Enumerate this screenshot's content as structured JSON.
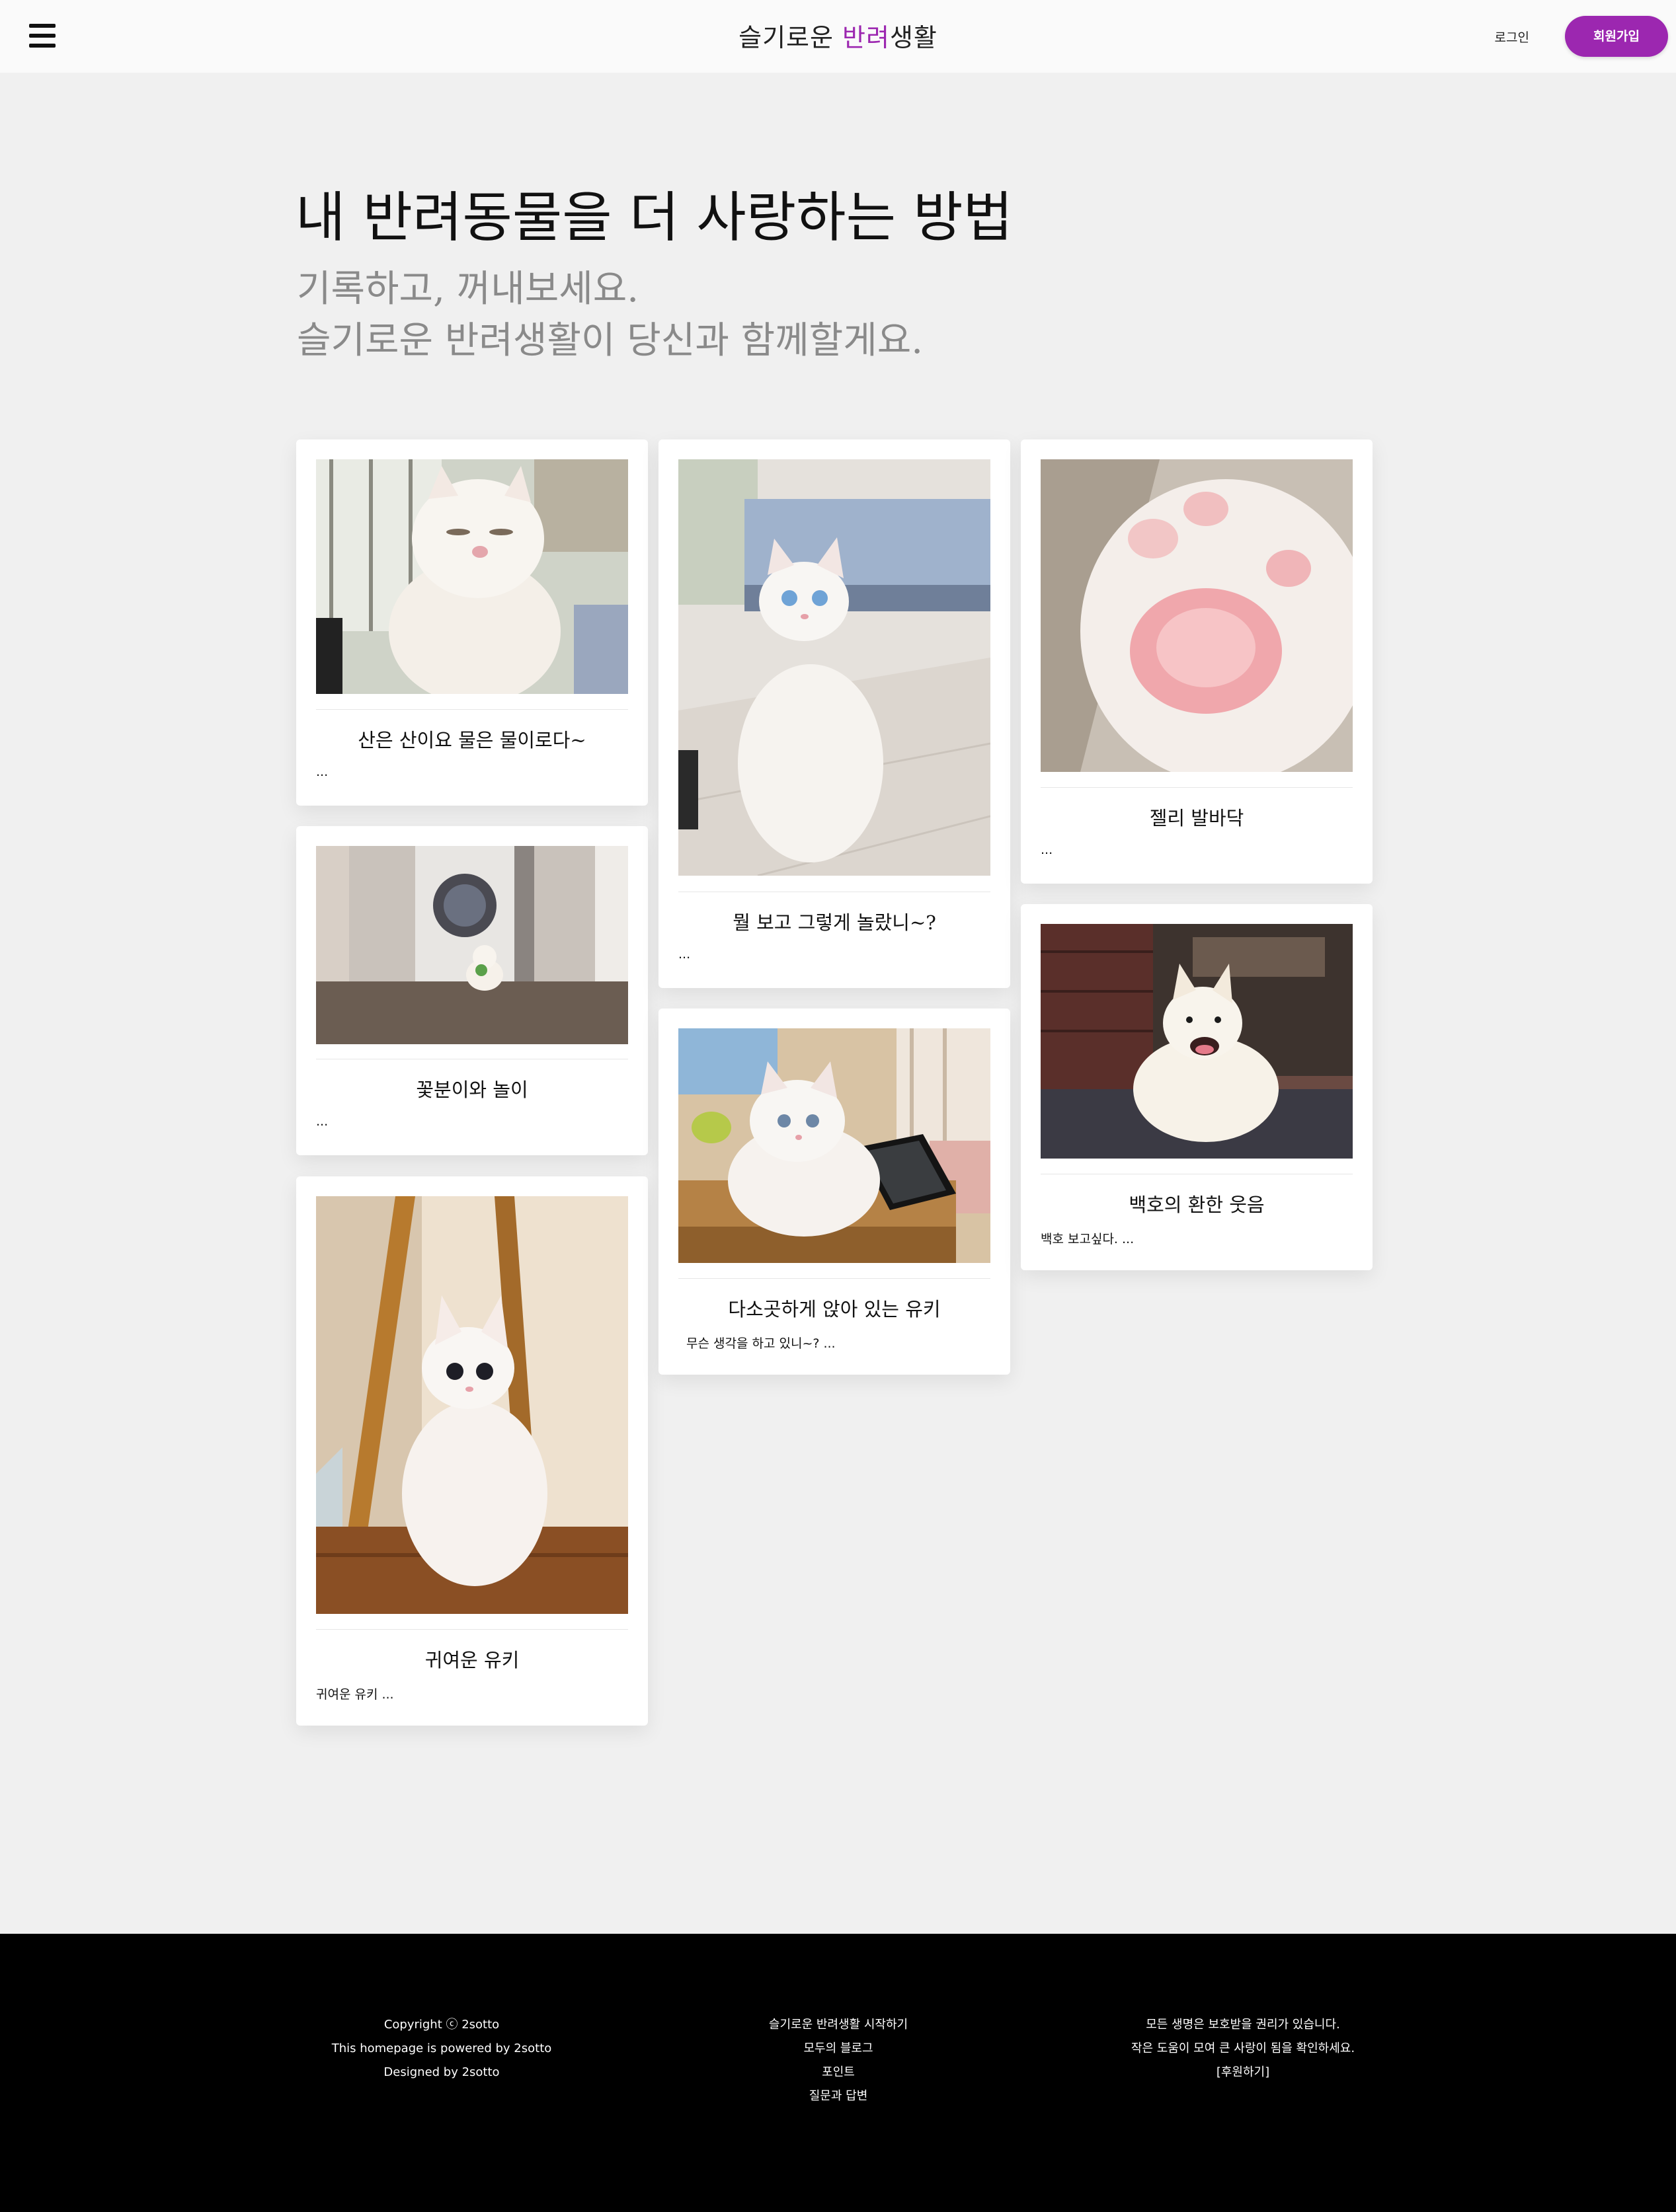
{
  "header": {
    "menu_icon": "hamburger-menu-icon",
    "brand_part1": "슬기로운 ",
    "brand_accent": "반려",
    "brand_part2": "생활",
    "login_label": "로그인",
    "signup_label": "회원가입",
    "accent_color": "#9c27b0"
  },
  "hero": {
    "title": "내 반려동물을 더 사랑하는 방법",
    "subtitle_line1": "기록하고, 꺼내보세요.",
    "subtitle_line2": "슬기로운 반려생활이 당신과 함께할게요."
  },
  "posts": [
    {
      "title": "산은 산이요 물은 물이로다~",
      "excerpt": "...",
      "image": "white persian cat lying down, squinting, by a window"
    },
    {
      "title": "꽃분이와 놀이",
      "excerpt": "...",
      "image": "small white pomeranian holding a green toy in a hallway with washing machine"
    },
    {
      "title": "귀여운 유키",
      "excerpt": "귀여운 유키 ...",
      "image": "white persian kitten sitting beside a wooden easel"
    },
    {
      "title": "뭘 보고 그렇게 놀랐니~?",
      "excerpt": "...",
      "image": "white cat with blue eyes sitting on a wooden floor looking up"
    },
    {
      "title": "다소곳하게 앉아 있는 유키",
      "excerpt": "무슨 생각을 하고 있니~? ...",
      "image": "white fluffy cat sitting on a desk next to a tablet"
    },
    {
      "title": "젤리 발바닥",
      "excerpt": "...",
      "image": "close-up of a white cat paw with pink toe beans"
    },
    {
      "title": "백호의 환한 웃음",
      "excerpt": "백호 보고싶다. ...",
      "image": "smiling white jindo dog sitting in front of a door"
    }
  ],
  "footer": {
    "col1": [
      "Copyright ⓒ 2sotto",
      "This homepage is powered by 2sotto",
      "Designed by 2sotto"
    ],
    "col2": [
      "슬기로운 반려생활 시작하기",
      "모두의 블로그",
      "포인트",
      "질문과 답변"
    ],
    "col3": [
      "모든 생명은 보호받을 권리가 있습니다.",
      "작은 도움이 모여 큰 사랑이 됨을 확인하세요.",
      "[후원하기]"
    ]
  }
}
